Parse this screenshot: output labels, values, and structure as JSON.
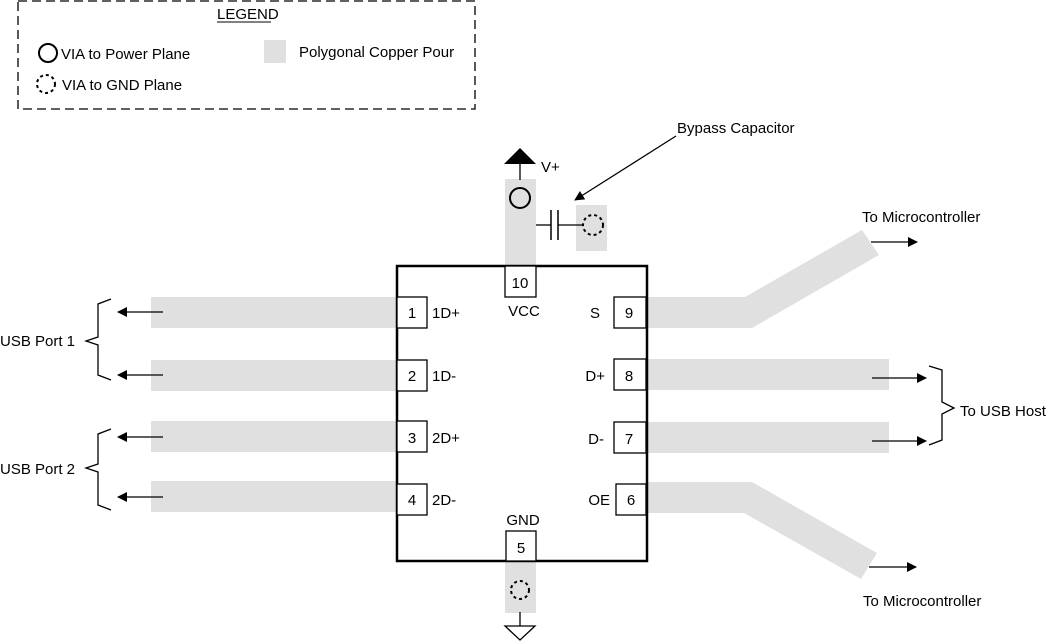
{
  "legend": {
    "title": "LEGEND",
    "items": [
      {
        "icon": "via-power-icon",
        "label": "VIA to Power Plane"
      },
      {
        "icon": "via-gnd-icon",
        "label": "VIA to GND Plane"
      },
      {
        "icon": "copper-pour-swatch",
        "label": "Polygonal Copper Pour"
      }
    ]
  },
  "colors": {
    "copper_pour": "#e0e0e0",
    "stroke": "#000000"
  },
  "ic": {
    "pins": [
      {
        "number": "1",
        "name": "1D+"
      },
      {
        "number": "2",
        "name": "1D-"
      },
      {
        "number": "3",
        "name": "2D+"
      },
      {
        "number": "4",
        "name": "2D-"
      },
      {
        "number": "5",
        "name": "GND"
      },
      {
        "number": "6",
        "name": "OE"
      },
      {
        "number": "7",
        "name": "D-"
      },
      {
        "number": "8",
        "name": "D+"
      },
      {
        "number": "9",
        "name": "S"
      },
      {
        "number": "10",
        "name": "VCC"
      }
    ]
  },
  "labels": {
    "power_supply": "V+",
    "bypass_capacitor": "Bypass Capacitor",
    "usb_port_1": "USB Port 1",
    "usb_port_2": "USB Port 2",
    "to_usb_host": "To USB Host",
    "to_microcontroller_top": "To Microcontroller",
    "to_microcontroller_bottom": "To Microcontroller"
  }
}
